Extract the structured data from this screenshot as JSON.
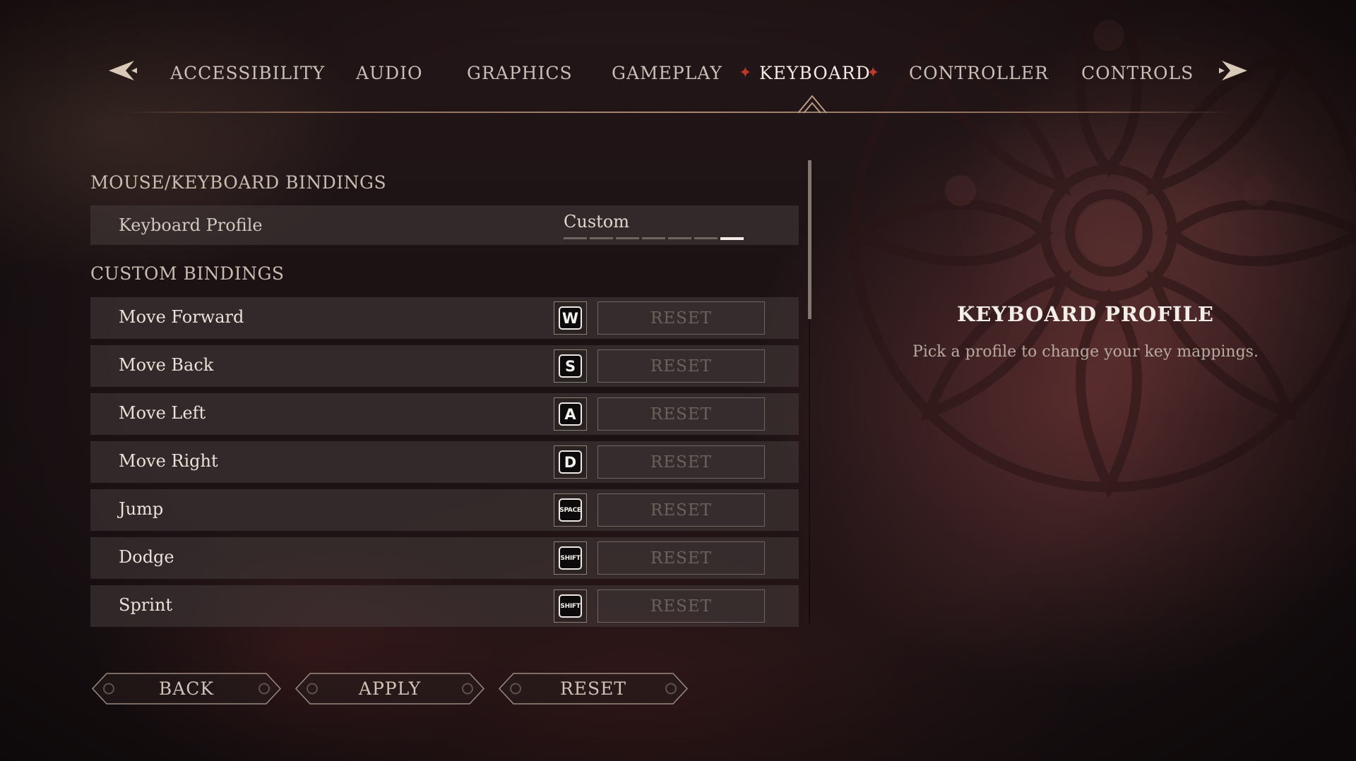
{
  "nav": {
    "tabs": [
      {
        "label": "ACCESSIBILITY"
      },
      {
        "label": "AUDIO"
      },
      {
        "label": "GRAPHICS"
      },
      {
        "label": "GAMEPLAY"
      },
      {
        "label": "KEYBOARD",
        "active": true
      },
      {
        "label": "CONTROLLER"
      },
      {
        "label": "CONTROLS"
      }
    ],
    "prev_icon": "arrow-left-icon",
    "next_icon": "arrow-right-icon",
    "active_marker": "star-icon"
  },
  "bindings": {
    "section_title": "MOUSE/KEYBOARD BINDINGS",
    "profile": {
      "label": "Keyboard Profile",
      "value": "Custom",
      "option_count": 7,
      "selected_index": 6
    },
    "custom_title": "CUSTOM BINDINGS",
    "rows": [
      {
        "action": "Move Forward",
        "key": "W",
        "reset": "RESET"
      },
      {
        "action": "Move Back",
        "key": "S",
        "reset": "RESET"
      },
      {
        "action": "Move Left",
        "key": "A",
        "reset": "RESET"
      },
      {
        "action": "Move Right",
        "key": "D",
        "reset": "RESET"
      },
      {
        "action": "Jump",
        "key": "SPACE",
        "reset": "RESET"
      },
      {
        "action": "Dodge",
        "key": "SHIFT",
        "reset": "RESET"
      },
      {
        "action": "Sprint",
        "key": "SHIFT",
        "reset": "RESET"
      }
    ]
  },
  "description": {
    "title": "KEYBOARD PROFILE",
    "text": "Pick a profile to change your key mappings."
  },
  "buttons": {
    "back": "BACK",
    "apply": "APPLY",
    "reset": "RESET"
  },
  "colors": {
    "accent": "#c0392b",
    "row_bg": "#463c3c",
    "text": "#eae2d9"
  }
}
